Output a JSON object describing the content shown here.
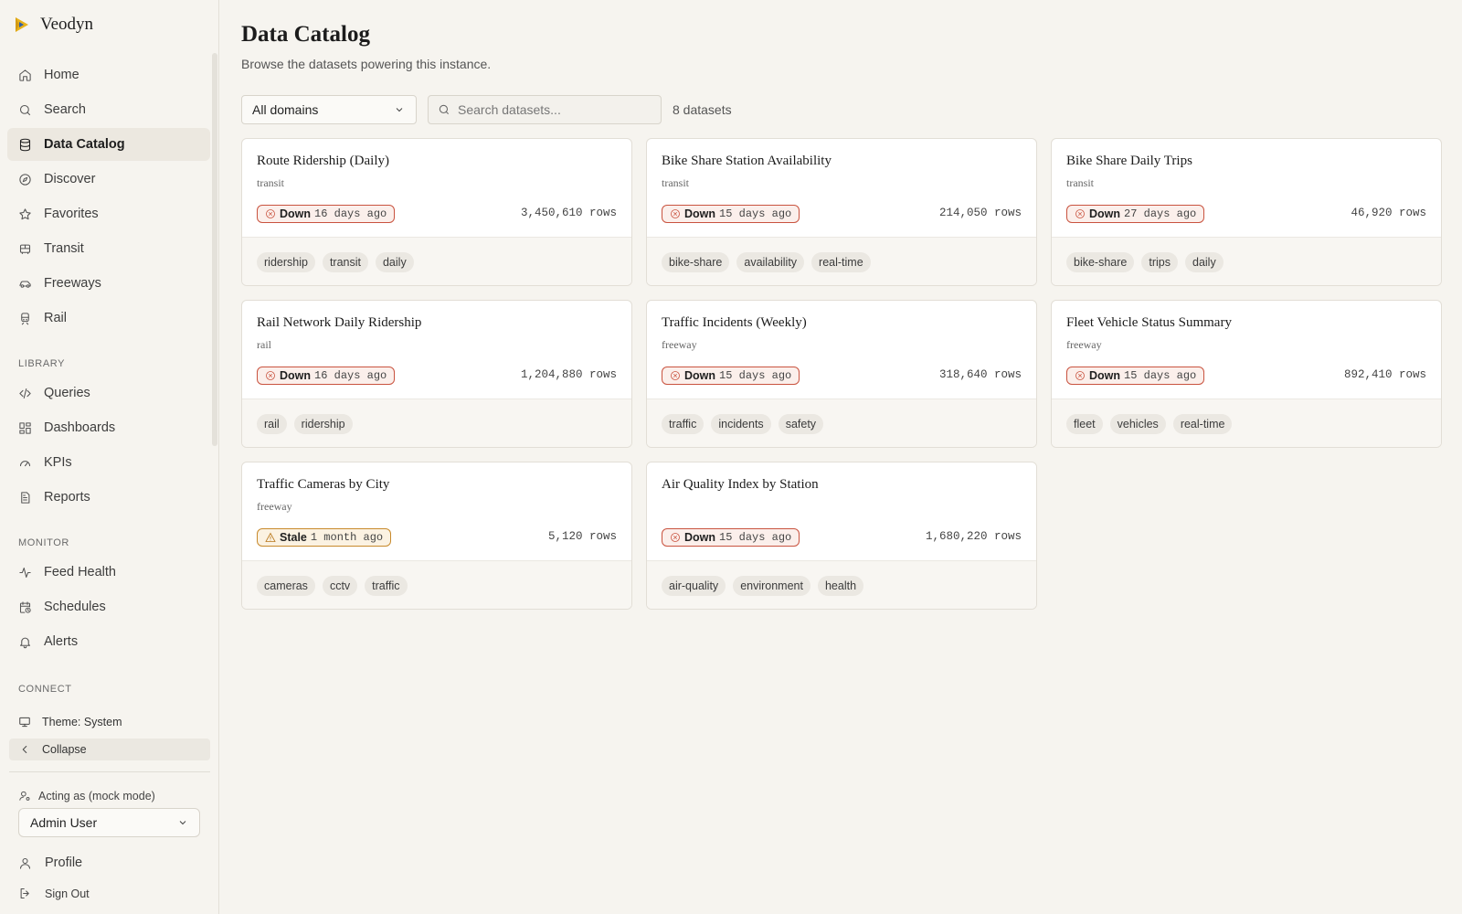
{
  "app": {
    "name": "Veodyn"
  },
  "sidebar": {
    "nav": [
      {
        "label": "Home",
        "icon": "home-icon"
      },
      {
        "label": "Search",
        "icon": "search-icon"
      },
      {
        "label": "Data Catalog",
        "icon": "database-icon",
        "active": true
      },
      {
        "label": "Discover",
        "icon": "compass-icon"
      },
      {
        "label": "Favorites",
        "icon": "star-icon"
      },
      {
        "label": "Transit",
        "icon": "bus-icon"
      },
      {
        "label": "Freeways",
        "icon": "car-icon"
      },
      {
        "label": "Rail",
        "icon": "train-icon"
      }
    ],
    "library_label": "LIBRARY",
    "library": [
      {
        "label": "Queries",
        "icon": "code-icon"
      },
      {
        "label": "Dashboards",
        "icon": "dashboard-icon"
      },
      {
        "label": "KPIs",
        "icon": "gauge-icon"
      },
      {
        "label": "Reports",
        "icon": "report-icon"
      }
    ],
    "monitor_label": "MONITOR",
    "monitor": [
      {
        "label": "Feed Health",
        "icon": "activity-icon"
      },
      {
        "label": "Schedules",
        "icon": "calendar-clock-icon"
      },
      {
        "label": "Alerts",
        "icon": "bell-icon"
      }
    ],
    "connect_label": "CONNECT",
    "theme_label": "Theme: System",
    "collapse_label": "Collapse",
    "acting_label": "Acting as (mock mode)",
    "acting_user": "Admin User",
    "profile_label": "Profile",
    "signout_label": "Sign Out"
  },
  "main": {
    "title": "Data Catalog",
    "subtitle": "Browse the datasets powering this instance.",
    "domain_filter": "All domains",
    "search_placeholder": "Search datasets...",
    "count": "8 datasets"
  },
  "datasets": [
    {
      "title": "Route Ridership (Daily)",
      "domain": "transit",
      "status": "Down",
      "ago": "16 days ago",
      "rows": "3,450,610 rows",
      "tags": [
        "ridership",
        "transit",
        "daily"
      ]
    },
    {
      "title": "Bike Share Station Availability",
      "domain": "transit",
      "status": "Down",
      "ago": "15 days ago",
      "rows": "214,050 rows",
      "tags": [
        "bike-share",
        "availability",
        "real-time"
      ]
    },
    {
      "title": "Bike Share Daily Trips",
      "domain": "transit",
      "status": "Down",
      "ago": "27 days ago",
      "rows": "46,920 rows",
      "tags": [
        "bike-share",
        "trips",
        "daily"
      ]
    },
    {
      "title": "Rail Network Daily Ridership",
      "domain": "rail",
      "status": "Down",
      "ago": "16 days ago",
      "rows": "1,204,880 rows",
      "tags": [
        "rail",
        "ridership"
      ]
    },
    {
      "title": "Traffic Incidents (Weekly)",
      "domain": "freeway",
      "status": "Down",
      "ago": "15 days ago",
      "rows": "318,640 rows",
      "tags": [
        "traffic",
        "incidents",
        "safety"
      ]
    },
    {
      "title": "Fleet Vehicle Status Summary",
      "domain": "freeway",
      "status": "Down",
      "ago": "15 days ago",
      "rows": "892,410 rows",
      "tags": [
        "fleet",
        "vehicles",
        "real-time"
      ]
    },
    {
      "title": "Traffic Cameras by City",
      "domain": "freeway",
      "status": "Stale",
      "ago": "1 month ago",
      "rows": "5,120 rows",
      "tags": [
        "cameras",
        "cctv",
        "traffic"
      ]
    },
    {
      "title": "Air Quality Index by Station",
      "domain": "",
      "status": "Down",
      "ago": "15 days ago",
      "rows": "1,680,220 rows",
      "tags": [
        "air-quality",
        "environment",
        "health"
      ]
    }
  ],
  "colors": {
    "down_border": "#c9533f",
    "stale_border": "#c88a2c",
    "brand_yellow": "#e8b21a",
    "brand_blue": "#2f5fa8"
  }
}
